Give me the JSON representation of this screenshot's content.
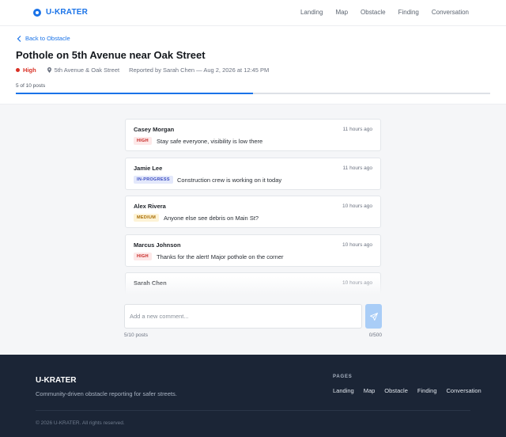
{
  "app": {
    "name": "U-KRATER",
    "accent": "#1a73e8"
  },
  "nav": [
    "Landing",
    "Map",
    "Obstacle",
    "Finding",
    "Conversation"
  ],
  "obstacle": {
    "back_label": "Back to Obstacle",
    "title": "Pothole on 5th Avenue near Oak Street",
    "severity": "High",
    "location": "5th Avenue & Oak Street",
    "reported": "Reported by Sarah Chen — Aug 2, 2026 at 12:45 PM",
    "progress_label": "5 of 10 posts",
    "progress_fraction": 0.5
  },
  "posts": [
    {
      "author": "Casey Morgan",
      "time": "11 hours ago",
      "badge": "HIGH",
      "badge_type": "high",
      "text": "Stay safe everyone, visibility is low there"
    },
    {
      "author": "Jamie Lee",
      "time": "11 hours ago",
      "badge": "IN-PROGRESS",
      "badge_type": "inprogress",
      "text": "Construction crew is working on it today"
    },
    {
      "author": "Alex Rivera",
      "time": "10 hours ago",
      "badge": "MEDIUM",
      "badge_type": "medium",
      "text": "Anyone else see debris on Main St?"
    },
    {
      "author": "Marcus Johnson",
      "time": "10 hours ago",
      "badge": "HIGH",
      "badge_type": "high",
      "text": "Thanks for the alert! Major pothole on the corner"
    },
    {
      "author": "Sarah Chen",
      "time": "10 hours ago",
      "badge": "",
      "badge_type": "",
      "text": ""
    }
  ],
  "composer": {
    "placeholder": "Add a new comment...",
    "value": "",
    "post_count": "5/10 posts",
    "char_count": "0/500"
  },
  "footer": {
    "name": "U-KRATER",
    "tagline": "Community-driven obstacle reporting for safer streets.",
    "pages_heading": "PAGES",
    "links": [
      "Landing",
      "Map",
      "Obstacle",
      "Finding",
      "Conversation"
    ],
    "copyright": "© 2026 U-KRATER. All rights reserved."
  }
}
